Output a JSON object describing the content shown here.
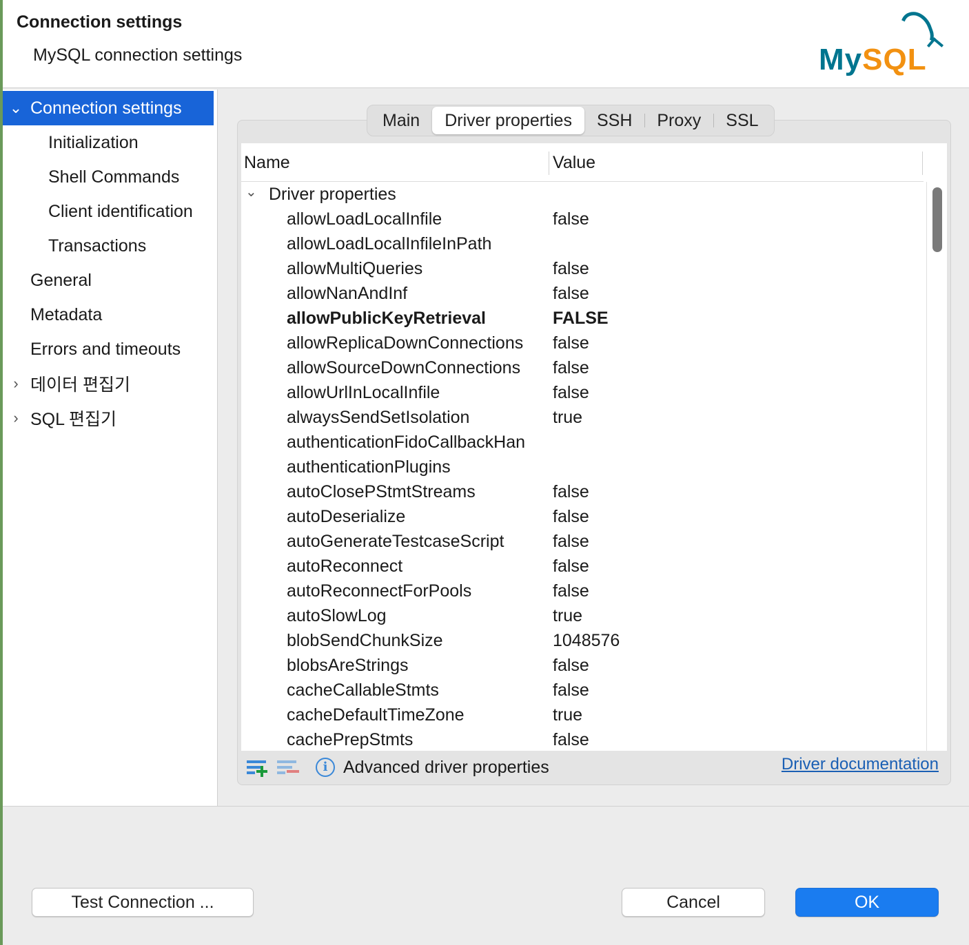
{
  "header": {
    "title": "Connection settings",
    "subtitle": "MySQL connection settings",
    "logo_text_my": "My",
    "logo_text_sql": "SQL"
  },
  "sidebar": {
    "items": [
      {
        "label": "Connection settings",
        "level": 0,
        "expanded": true,
        "selected": true
      },
      {
        "label": "Initialization",
        "level": 1
      },
      {
        "label": "Shell Commands",
        "level": 1
      },
      {
        "label": "Client identification",
        "level": 1
      },
      {
        "label": "Transactions",
        "level": 1
      },
      {
        "label": "General",
        "level": 0
      },
      {
        "label": "Metadata",
        "level": 0
      },
      {
        "label": "Errors and timeouts",
        "level": 0
      },
      {
        "label": "데이터 편집기",
        "level": 0,
        "collapsed": true
      },
      {
        "label": "SQL 편집기",
        "level": 0,
        "collapsed": true
      }
    ]
  },
  "tabs": [
    {
      "label": "Main"
    },
    {
      "label": "Driver properties",
      "active": true
    },
    {
      "label": "SSH"
    },
    {
      "label": "Proxy"
    },
    {
      "label": "SSL"
    }
  ],
  "table": {
    "columns": [
      "Name",
      "Value"
    ],
    "group": "Driver properties",
    "rows": [
      {
        "name": "allowLoadLocalInfile",
        "value": "false"
      },
      {
        "name": "allowLoadLocalInfileInPath",
        "value": ""
      },
      {
        "name": "allowMultiQueries",
        "value": "false"
      },
      {
        "name": "allowNanAndInf",
        "value": "false"
      },
      {
        "name": "allowPublicKeyRetrieval",
        "value": "FALSE",
        "bold": true
      },
      {
        "name": "allowReplicaDownConnections",
        "value": "false"
      },
      {
        "name": "allowSourceDownConnections",
        "value": "false"
      },
      {
        "name": "allowUrlInLocalInfile",
        "value": "false"
      },
      {
        "name": "alwaysSendSetIsolation",
        "value": "true"
      },
      {
        "name": "authenticationFidoCallbackHan",
        "value": ""
      },
      {
        "name": "authenticationPlugins",
        "value": ""
      },
      {
        "name": "autoClosePStmtStreams",
        "value": "false"
      },
      {
        "name": "autoDeserialize",
        "value": "false"
      },
      {
        "name": "autoGenerateTestcaseScript",
        "value": "false"
      },
      {
        "name": "autoReconnect",
        "value": "false"
      },
      {
        "name": "autoReconnectForPools",
        "value": "false"
      },
      {
        "name": "autoSlowLog",
        "value": "true"
      },
      {
        "name": "blobSendChunkSize",
        "value": "1048576"
      },
      {
        "name": "blobsAreStrings",
        "value": "false"
      },
      {
        "name": "cacheCallableStmts",
        "value": "false"
      },
      {
        "name": "cacheDefaultTimeZone",
        "value": "true"
      },
      {
        "name": "cachePrepStmts",
        "value": "false"
      }
    ]
  },
  "footer": {
    "advanced_label": "Advanced driver properties",
    "doc_link": "Driver documentation"
  },
  "buttons": {
    "test": "Test Connection ...",
    "cancel": "Cancel",
    "ok": "OK"
  },
  "colors": {
    "accent": "#1864d8",
    "ok_button": "#1a7cf0",
    "link": "#1a5fb4",
    "logo_blue": "#00758f",
    "logo_orange": "#f29111"
  }
}
